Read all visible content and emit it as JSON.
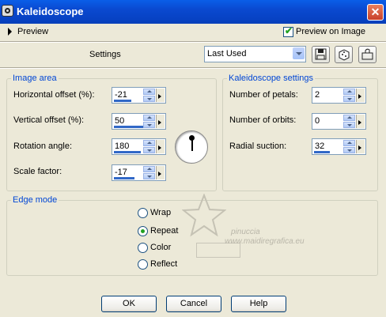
{
  "window": {
    "title": "Kaleidoscope"
  },
  "preview": {
    "label": "Preview",
    "on_image_label": "Preview on Image",
    "on_image_checked": true
  },
  "settings": {
    "label": "Settings",
    "preset_value": "Last Used"
  },
  "image_area": {
    "title": "Image area",
    "horizontal_offset": {
      "label": "Horizontal offset (%):",
      "value": "-21"
    },
    "vertical_offset": {
      "label": "Vertical offset (%):",
      "value": "50"
    },
    "rotation_angle": {
      "label": "Rotation angle:",
      "value": "180"
    },
    "scale_factor": {
      "label": "Scale factor:",
      "value": "-17"
    }
  },
  "kaleidoscope_settings": {
    "title": "Kaleidoscope settings",
    "petals": {
      "label": "Number of petals:",
      "value": "2"
    },
    "orbits": {
      "label": "Number of orbits:",
      "value": "0"
    },
    "radial_suction": {
      "label": "Radial suction:",
      "value": "32"
    }
  },
  "edge_mode": {
    "title": "Edge mode",
    "options": [
      "Wrap",
      "Repeat",
      "Color",
      "Reflect"
    ],
    "selected": "Repeat"
  },
  "buttons": {
    "ok": "OK",
    "cancel": "Cancel",
    "help": "Help"
  },
  "watermark": {
    "line1": "pinuccia",
    "line2": "www.maidiregrafica.eu"
  },
  "colors": {
    "title_bar": "#0a49d0",
    "group_title": "#0046d5",
    "dialog_bg": "#ece9d8",
    "accent_bar": "#3168c7"
  }
}
